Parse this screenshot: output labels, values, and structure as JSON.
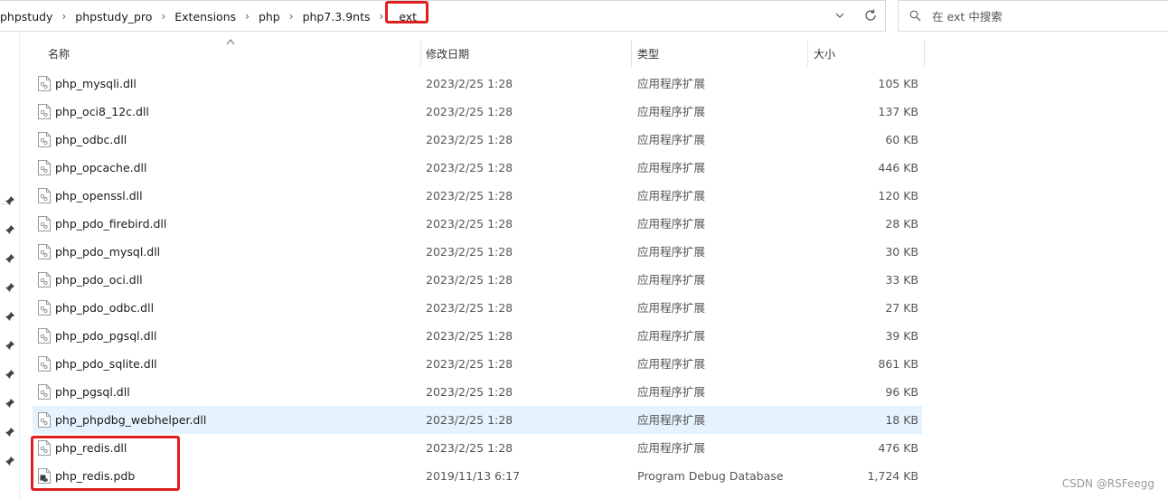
{
  "address_bar": {
    "crumbs": [
      "phpstudy",
      "phpstudy_pro",
      "Extensions",
      "php",
      "php7.3.9nts",
      "ext"
    ]
  },
  "search": {
    "placeholder": "在 ext 中搜索"
  },
  "columns": {
    "name": "名称",
    "date": "修改日期",
    "type": "类型",
    "size": "大小"
  },
  "files": [
    {
      "name": "php_mysqli.dll",
      "date": "2023/2/25 1:28",
      "type": "应用程序扩展",
      "size": "105 KB",
      "icon": "dll-file-icon"
    },
    {
      "name": "php_oci8_12c.dll",
      "date": "2023/2/25 1:28",
      "type": "应用程序扩展",
      "size": "137 KB",
      "icon": "dll-file-icon"
    },
    {
      "name": "php_odbc.dll",
      "date": "2023/2/25 1:28",
      "type": "应用程序扩展",
      "size": "60 KB",
      "icon": "dll-file-icon"
    },
    {
      "name": "php_opcache.dll",
      "date": "2023/2/25 1:28",
      "type": "应用程序扩展",
      "size": "446 KB",
      "icon": "dll-file-icon"
    },
    {
      "name": "php_openssl.dll",
      "date": "2023/2/25 1:28",
      "type": "应用程序扩展",
      "size": "120 KB",
      "icon": "dll-file-icon"
    },
    {
      "name": "php_pdo_firebird.dll",
      "date": "2023/2/25 1:28",
      "type": "应用程序扩展",
      "size": "28 KB",
      "icon": "dll-file-icon"
    },
    {
      "name": "php_pdo_mysql.dll",
      "date": "2023/2/25 1:28",
      "type": "应用程序扩展",
      "size": "30 KB",
      "icon": "dll-file-icon"
    },
    {
      "name": "php_pdo_oci.dll",
      "date": "2023/2/25 1:28",
      "type": "应用程序扩展",
      "size": "33 KB",
      "icon": "dll-file-icon"
    },
    {
      "name": "php_pdo_odbc.dll",
      "date": "2023/2/25 1:28",
      "type": "应用程序扩展",
      "size": "27 KB",
      "icon": "dll-file-icon"
    },
    {
      "name": "php_pdo_pgsql.dll",
      "date": "2023/2/25 1:28",
      "type": "应用程序扩展",
      "size": "39 KB",
      "icon": "dll-file-icon"
    },
    {
      "name": "php_pdo_sqlite.dll",
      "date": "2023/2/25 1:28",
      "type": "应用程序扩展",
      "size": "861 KB",
      "icon": "dll-file-icon"
    },
    {
      "name": "php_pgsql.dll",
      "date": "2023/2/25 1:28",
      "type": "应用程序扩展",
      "size": "96 KB",
      "icon": "dll-file-icon"
    },
    {
      "name": "php_phpdbg_webhelper.dll",
      "date": "2023/2/25 1:28",
      "type": "应用程序扩展",
      "size": "18 KB",
      "icon": "dll-file-icon",
      "hover": true
    },
    {
      "name": "php_redis.dll",
      "date": "2023/2/25 1:28",
      "type": "应用程序扩展",
      "size": "476 KB",
      "icon": "dll-file-icon"
    },
    {
      "name": "php_redis.pdb",
      "date": "2019/11/13 6:17",
      "type": "Program Debug Database",
      "size": "1,724 KB",
      "icon": "pdb-file-icon"
    }
  ],
  "watermark": "CSDN @RSFeegg",
  "colors": {
    "highlight_red": "#e02020",
    "hover_row": "#e5f3ff"
  }
}
